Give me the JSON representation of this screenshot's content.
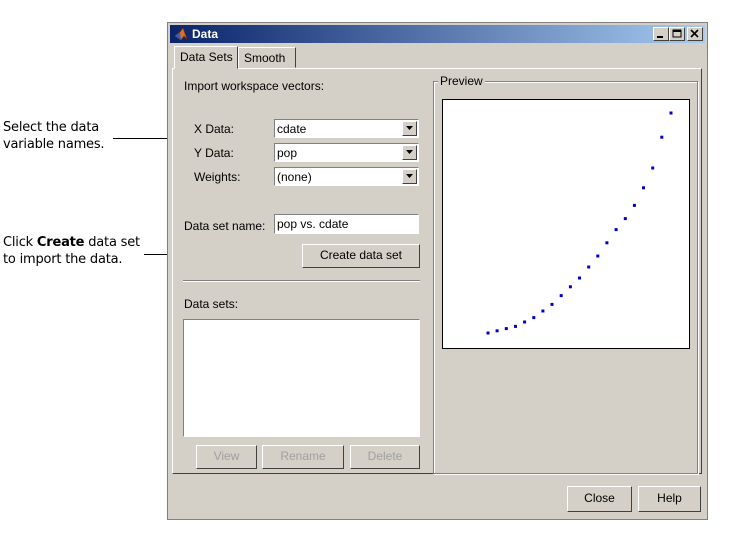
{
  "callouts": {
    "select": {
      "line1": "Select the data",
      "line2": "variable names."
    },
    "create": {
      "line1_prefix": "Click ",
      "line1_bold": "Create",
      "line1_suffix": " data set",
      "line2": "to import the data."
    }
  },
  "window": {
    "title": "Data",
    "controls": {
      "minimize": "_",
      "maximize": "□",
      "close": "×"
    }
  },
  "tabs": [
    {
      "label": "Data Sets"
    },
    {
      "label": "Smooth"
    }
  ],
  "import": {
    "heading": "Import workspace vectors:",
    "x_label": "X Data:",
    "x_value": "cdate",
    "y_label": "Y Data:",
    "y_value": "pop",
    "weights_label": "Weights:",
    "weights_value": "(none)",
    "name_label": "Data set name:",
    "name_value": "pop vs. cdate",
    "create_button": "Create data set"
  },
  "datasets": {
    "heading": "Data sets:",
    "view_button": "View",
    "rename_button": "Rename",
    "delete_button": "Delete"
  },
  "preview": {
    "title": "Preview",
    "chart_data": {
      "type": "scatter",
      "title": "",
      "xlabel": "",
      "ylabel": "",
      "marker_color": "#0000cc",
      "points": [
        [
          0.0,
          0.0
        ],
        [
          0.05,
          0.01
        ],
        [
          0.1,
          0.02
        ],
        [
          0.15,
          0.03
        ],
        [
          0.2,
          0.05
        ],
        [
          0.25,
          0.07
        ],
        [
          0.3,
          0.1
        ],
        [
          0.35,
          0.13
        ],
        [
          0.4,
          0.17
        ],
        [
          0.45,
          0.21
        ],
        [
          0.5,
          0.25
        ],
        [
          0.55,
          0.3
        ],
        [
          0.6,
          0.35
        ],
        [
          0.65,
          0.41
        ],
        [
          0.7,
          0.47
        ],
        [
          0.75,
          0.52
        ],
        [
          0.8,
          0.58
        ],
        [
          0.85,
          0.66
        ],
        [
          0.9,
          0.75
        ],
        [
          0.95,
          0.89
        ],
        [
          1.0,
          1.0
        ]
      ]
    }
  },
  "footer": {
    "close_button": "Close",
    "help_button": "Help"
  }
}
